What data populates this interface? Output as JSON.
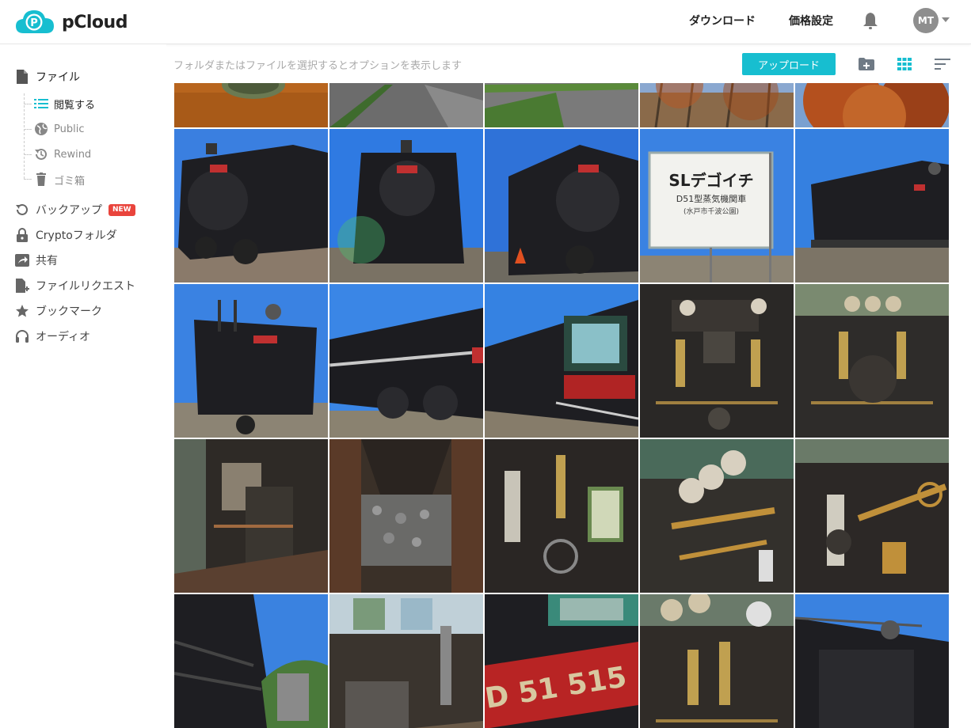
{
  "header": {
    "logo_text": "pCloud",
    "links": [
      "ダウンロード",
      "価格設定"
    ],
    "avatar_initials": "MT",
    "logo_color": "#17bed0"
  },
  "sidebar": {
    "items": [
      {
        "label": "ファイル",
        "icon": "file-icon"
      },
      {
        "label": "バックアップ",
        "icon": "backup-icon",
        "badge": "NEW"
      },
      {
        "label": "Cryptoフォルダ",
        "icon": "lock-icon"
      },
      {
        "label": "共有",
        "icon": "share-icon"
      },
      {
        "label": "ファイルリクエスト",
        "icon": "file-request-icon"
      },
      {
        "label": "ブックマーク",
        "icon": "star-icon"
      },
      {
        "label": "オーディオ",
        "icon": "headphones-icon"
      }
    ],
    "subitems": [
      {
        "label": "閲覧する",
        "icon": "list-icon"
      },
      {
        "label": "Public",
        "icon": "globe-icon"
      },
      {
        "label": "Rewind",
        "icon": "rewind-icon"
      },
      {
        "label": "ゴミ箱",
        "icon": "trash-icon"
      }
    ]
  },
  "toolbar": {
    "hint": "フォルダまたはファイルを選択するとオプションを表示します",
    "upload_label": "アップロード",
    "accent": "#17bed0"
  }
}
